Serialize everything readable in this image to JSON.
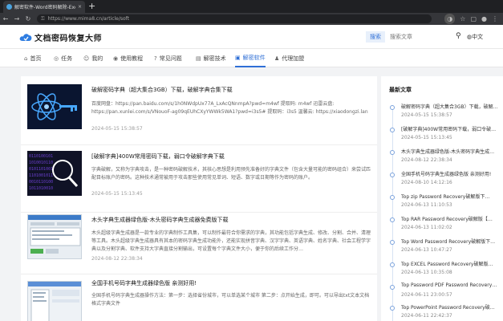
{
  "browser": {
    "tab_title": "解密软件-Word密码解除-Excel密",
    "tab_close": "×",
    "new_tab": "+",
    "url": "https://www.mima8.cn/article/soft"
  },
  "site": {
    "logo_text": "文档密码恢复大师",
    "search_tab": "搜索",
    "search_placeholder": "搜索文章",
    "lang": "中文"
  },
  "nav": [
    {
      "label": "首页",
      "icon": "home-icon",
      "glyph": "⌂"
    },
    {
      "label": "任务",
      "icon": "task-icon",
      "glyph": "◎"
    },
    {
      "label": "我的",
      "icon": "user-icon",
      "glyph": "☺"
    },
    {
      "label": "使用教程",
      "icon": "tutorial-icon",
      "glyph": "◉"
    },
    {
      "label": "常见问题",
      "icon": "faq-icon",
      "glyph": "?"
    },
    {
      "label": "解密技术",
      "icon": "tech-icon",
      "glyph": "▤"
    },
    {
      "label": "解密软件",
      "icon": "software-icon",
      "glyph": "▣"
    },
    {
      "label": "代理加盟",
      "icon": "agent-icon",
      "glyph": "♟"
    }
  ],
  "articles": [
    {
      "title": "破解密码字典（超大集合3GB）下载，破解字典合集下载",
      "summary": "百度网盘：https://pan.baidu.com/s/1h0NWdpUx77A_LxAcQNnmpA?pwd=m4wf 提取码: m4wf 迅雷云盘: https://pan.xunlei.com/s/VNouoF-ag09qEUhCXyYWWk5WA1?pwd=i3s5# 提取码：i3s5 温馨云: https://xiaodongzi.lan",
      "date": "2024-05-15 15:38:57"
    },
    {
      "title": "[破解字典]400W常用密码下载，弱口令破解字典下载",
      "summary": "字典破解，又称为字典攻击，是一种密码破解技术，其核心思想是利用预先准备好的字典文件（包含大量可能的密码组合）来尝试匹配目标账户的密码。这种技术通常被用于攻击那些使用常见单词、短语、数字或日期等作为密码的账户。",
      "date": "2024-05-15 15:13:45"
    },
    {
      "title": "木头字典生成器绿色版-木头密码字典生成器免费版下载",
      "summary": "木头超级字典生成器是一款专业的字典制作工具集，可以制作最符合你需求的字典，其功能包括字典生成、修改、分割、合并、清理等工具。木头超级字典生成器具有其本的密码字典生成功能外，还能实现拼音字典、汉字字典、英语字典、姓名字典、社会工程学字典以及分割字典、软件支持大字典直接分割输出，可设置每个字典文件大小，便于你的后续工作分…",
      "date": "2024-08-12 22:38:34"
    },
    {
      "title": "全国手机号码字典生成器绿色版 亲测好用!",
      "summary": "全国手机号码字典生成器操作方法：第一步：选择省份城市，可以单选某个城市 第二步：点开始生成，即可。可以导出txt文本文档格式字典文件",
      "date": ""
    }
  ],
  "sidebar": {
    "title": "最新文章",
    "items": [
      {
        "title": "破解密码字典（超大集合3GB）下载，破解…",
        "date": "2024-05-15 15:38:57"
      },
      {
        "title": "[破解字典]400W常用密码下载，弱口令破…",
        "date": "2024-05-15 15:13:45"
      },
      {
        "title": "木头字典生成器绿色版-木头密码字典生成…",
        "date": "2024-08-12 22:38:34"
      },
      {
        "title": "全国手机号码字典生成器绿色版 亲测好用!",
        "date": "2024-08-10 14:12:16"
      },
      {
        "title": "Top zip Password Recovery破解版下…",
        "date": "2024-06-13 11:10:53"
      },
      {
        "title": "Top RAR Password Recovery破解版【…",
        "date": "2024-06-13 11:02:02"
      },
      {
        "title": "Top Word Password Recovery破解版下…",
        "date": "2024-06-13 10:47:27"
      },
      {
        "title": "Top EXCEL Password Recovery破解版…",
        "date": "2024-06-13 10:35:08"
      },
      {
        "title": "Top Password PDF Password Recovery…",
        "date": "2024-06-11 23:00:57"
      },
      {
        "title": "Top PowerPoint Password Recovery破…",
        "date": "2024-06-11 22:42:37"
      }
    ]
  }
}
